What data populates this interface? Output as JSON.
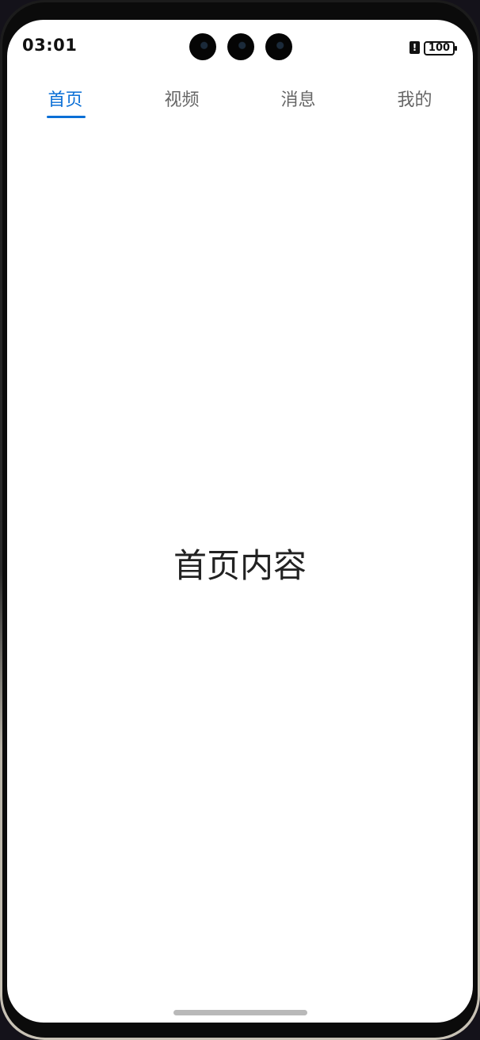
{
  "status_bar": {
    "time": "03:01",
    "alert_icon": "!",
    "battery_level": "100"
  },
  "tabs": [
    {
      "label": "首页",
      "active": true
    },
    {
      "label": "视频",
      "active": false
    },
    {
      "label": "消息",
      "active": false
    },
    {
      "label": "我的",
      "active": false
    }
  ],
  "content": {
    "text": "首页内容"
  },
  "colors": {
    "accent": "#0a6fd6",
    "tab_inactive": "#666666",
    "text": "#222222",
    "background": "#ffffff"
  },
  "icons": [
    "camera-icon",
    "camera-icon",
    "camera-icon",
    "alert-icon",
    "battery-icon"
  ]
}
